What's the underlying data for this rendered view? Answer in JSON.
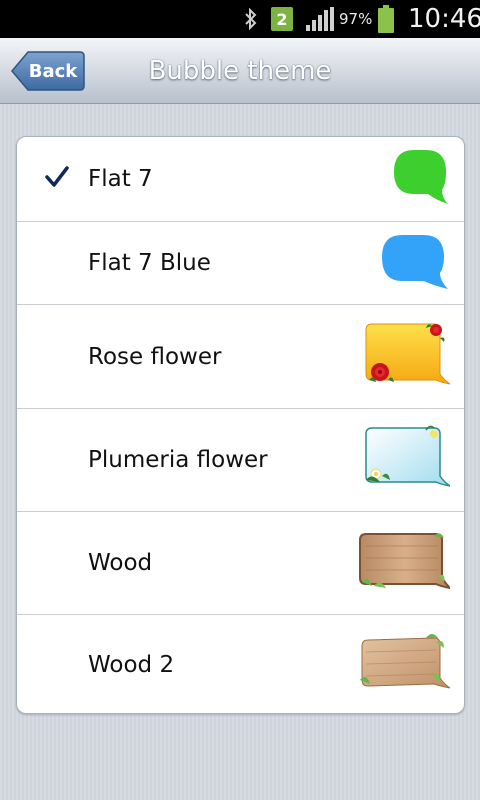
{
  "status_bar": {
    "notification_count": "2",
    "battery_percent": "97%",
    "time": "10:46",
    "icons": [
      "bluetooth-icon",
      "notification-badge",
      "signal-icon",
      "battery-icon"
    ]
  },
  "header": {
    "back_label": "Back",
    "title": "Bubble theme"
  },
  "themes": [
    {
      "label": "Flat 7",
      "selected": true,
      "preview": "green-flat-bubble",
      "color": "#3ccf2d"
    },
    {
      "label": "Flat 7 Blue",
      "selected": false,
      "preview": "blue-flat-bubble",
      "color": "#33a3f9"
    },
    {
      "label": "Rose flower",
      "selected": false,
      "preview": "rose-bubble",
      "color": "#f7c21c"
    },
    {
      "label": "Plumeria flower",
      "selected": false,
      "preview": "plumeria-bubble",
      "color": "#bfe9f3"
    },
    {
      "label": "Wood",
      "selected": false,
      "preview": "wood-bubble",
      "color": "#c59b74"
    },
    {
      "label": "Wood 2",
      "selected": false,
      "preview": "wood2-bubble",
      "color": "#d4ad85"
    }
  ],
  "colors": {
    "check": "#0f2a55",
    "back_button": "#4d7bb3",
    "title_bar": "#c9d0d9"
  }
}
